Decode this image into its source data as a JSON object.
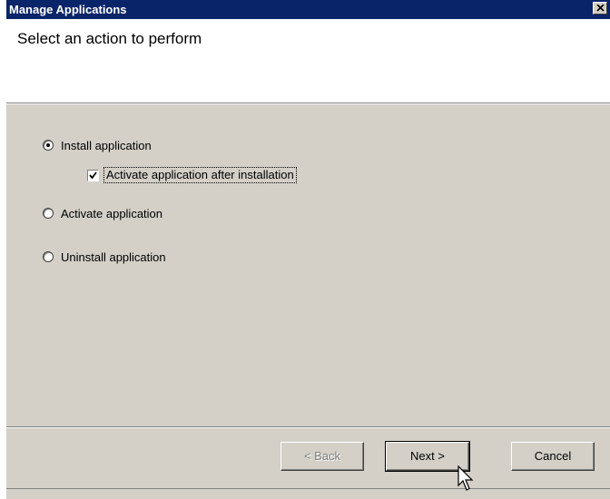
{
  "window": {
    "title": "Manage Applications"
  },
  "header": {
    "title": "Select an action to perform"
  },
  "options": {
    "install": {
      "label": "Install application",
      "selected": true
    },
    "activate_after_install": {
      "label": "Activate application after installation",
      "checked": true
    },
    "activate": {
      "label": "Activate application",
      "selected": false
    },
    "uninstall": {
      "label": "Uninstall application",
      "selected": false
    }
  },
  "buttons": {
    "back": "< Back",
    "next": "Next >",
    "cancel": "Cancel"
  },
  "icons": {
    "close": "close-icon",
    "check": "checkmark-icon",
    "cursor": "mouse-pointer-icon"
  },
  "colors": {
    "titlebar": "#0a246a",
    "dialog_face": "#d4d0c8",
    "header_bg": "#ffffff"
  }
}
